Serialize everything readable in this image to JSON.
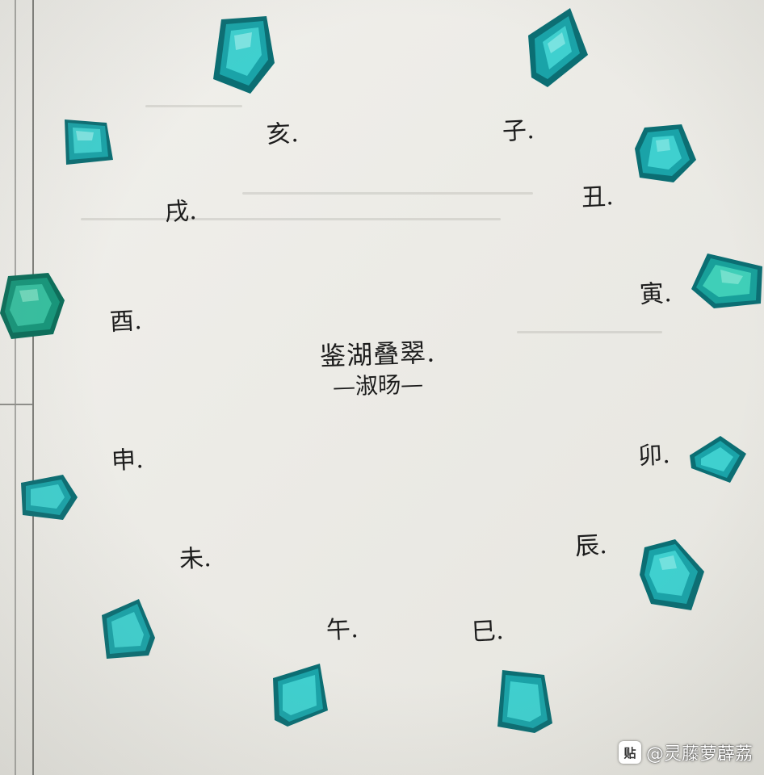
{
  "photo": {
    "center_title": "鉴湖叠翠.",
    "center_subtitle": "—淑旸—",
    "branch_labels": {
      "zi": "子.",
      "chou": "丑.",
      "yin": "寅.",
      "mao": "卯.",
      "chen": "辰.",
      "si": "巳.",
      "wu": "午.",
      "wei": "未.",
      "shen": "申.",
      "you": "酉.",
      "xu": "戌.",
      "hai": "亥."
    }
  },
  "watermark": {
    "icon_glyph": "贴",
    "handle": "@灵藤萝薜荔"
  },
  "colors": {
    "gem_dark": "#0b6e73",
    "gem_mid": "#139aa0",
    "gem_light": "#3fd0cf",
    "gem_highlight": "#a8f2ee",
    "ink": "#1d1d1d",
    "paper": "#ecebe6"
  }
}
